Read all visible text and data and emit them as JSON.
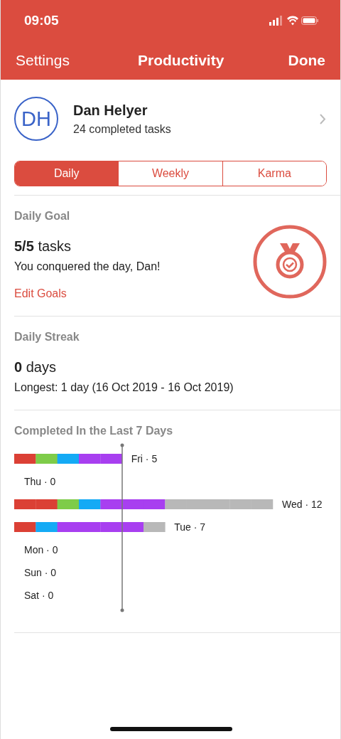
{
  "status_bar": {
    "time": "09:05"
  },
  "nav_bar": {
    "left": "Settings",
    "title": "Productivity",
    "right": "Done"
  },
  "profile": {
    "initials": "DH",
    "name": "Dan Helyer",
    "subtitle": "24 completed tasks"
  },
  "tabs": [
    {
      "label": "Daily",
      "selected": true
    },
    {
      "label": "Weekly",
      "selected": false
    },
    {
      "label": "Karma",
      "selected": false
    }
  ],
  "daily_goal": {
    "heading": "Daily Goal",
    "count": "5/5",
    "unit": "tasks",
    "message": "You conquered the day, Dan!",
    "link": "Edit Goals"
  },
  "daily_streak": {
    "heading": "Daily Streak",
    "count": "0",
    "unit": "days",
    "longest": "Longest: 1 day (16 Oct 2019 - 16 Oct 2019)"
  },
  "completed": {
    "heading": "Completed In the Last 7 Days",
    "days": [
      {
        "label": "Fri · 5",
        "tasks": [
          {
            "color": "#db4035"
          },
          {
            "color": "#7ecc49"
          },
          {
            "color": "#14aaf5"
          },
          {
            "color": "#a83ff0"
          },
          {
            "color": "#a83ff0"
          }
        ]
      },
      {
        "label": "Thu · 0"
      },
      {
        "label": "Wed · 12",
        "tasks": [
          {
            "color": "#db4035"
          },
          {
            "color": "#db4035"
          },
          {
            "color": "#7ecc49"
          },
          {
            "color": "#14aaf5"
          },
          {
            "color": "#a83ff0"
          },
          {
            "color": "#a83ff0"
          },
          {
            "color": "#a83ff0"
          },
          {
            "color": "#b8b8b8"
          },
          {
            "color": "#b8b8b8"
          },
          {
            "color": "#b8b8b8"
          },
          {
            "color": "#b8b8b8"
          },
          {
            "color": "#b8b8b8"
          }
        ]
      },
      {
        "label": "Tue · 7",
        "tasks": [
          {
            "color": "#db4035"
          },
          {
            "color": "#14aaf5"
          },
          {
            "color": "#a83ff0"
          },
          {
            "color": "#a83ff0"
          },
          {
            "color": "#a83ff0"
          },
          {
            "color": "#a83ff0"
          },
          {
            "color": "#b8b8b8"
          }
        ]
      },
      {
        "label": "Mon · 0"
      },
      {
        "label": "Sun · 0"
      },
      {
        "label": "Sat · 0"
      }
    ]
  }
}
